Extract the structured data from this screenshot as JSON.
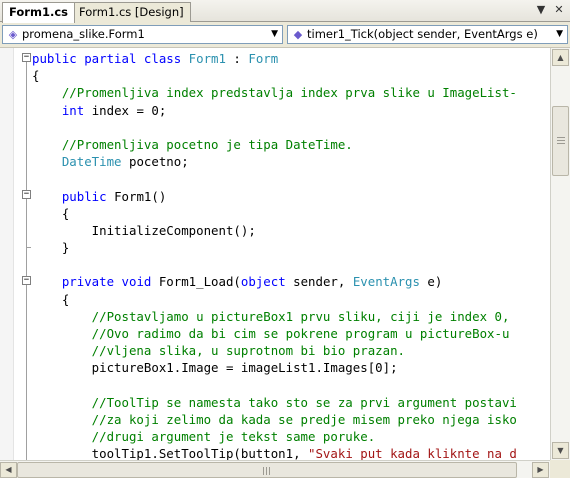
{
  "tabs": [
    {
      "label": "Form1.cs",
      "active": true
    },
    {
      "label": "Form1.cs [Design]",
      "active": false
    }
  ],
  "tab_buttons": {
    "dropdown_icon": "chevron-down-icon",
    "close_glyph": "✕"
  },
  "navigation": {
    "class_combo": {
      "value": "promena_slike.Form1",
      "icon": "class-icon"
    },
    "member_combo": {
      "value": "timer1_Tick(object sender, EventArgs e)",
      "icon": "method-icon"
    }
  },
  "code_lines": [
    [
      {
        "t": "public partial class ",
        "c": "kw"
      },
      {
        "t": "Form1",
        "c": "ty"
      },
      {
        "t": " : ",
        "c": ""
      },
      {
        "t": "Form",
        "c": "ty"
      }
    ],
    [
      {
        "t": "{",
        "c": ""
      }
    ],
    [
      {
        "t": "    //Promenljiva index predstavlja index prva slike u ImageList-",
        "c": "cm"
      }
    ],
    [
      {
        "t": "    ",
        "c": ""
      },
      {
        "t": "int",
        "c": "kw"
      },
      {
        "t": " index = 0;",
        "c": ""
      }
    ],
    [],
    [
      {
        "t": "    //Promenljiva pocetno je tipa DateTime.",
        "c": "cm"
      }
    ],
    [
      {
        "t": "    ",
        "c": ""
      },
      {
        "t": "DateTime",
        "c": "ty"
      },
      {
        "t": " pocetno;",
        "c": ""
      }
    ],
    [],
    [
      {
        "t": "    ",
        "c": ""
      },
      {
        "t": "public",
        "c": "kw"
      },
      {
        "t": " Form1()",
        "c": ""
      }
    ],
    [
      {
        "t": "    {",
        "c": ""
      }
    ],
    [
      {
        "t": "        InitializeComponent();",
        "c": ""
      }
    ],
    [
      {
        "t": "    }",
        "c": ""
      }
    ],
    [],
    [
      {
        "t": "    ",
        "c": ""
      },
      {
        "t": "private",
        "c": "kw"
      },
      {
        "t": " ",
        "c": ""
      },
      {
        "t": "void",
        "c": "kw"
      },
      {
        "t": " Form1_Load(",
        "c": ""
      },
      {
        "t": "object",
        "c": "kw"
      },
      {
        "t": " sender, ",
        "c": ""
      },
      {
        "t": "EventArgs",
        "c": "ty"
      },
      {
        "t": " e)",
        "c": ""
      }
    ],
    [
      {
        "t": "    {",
        "c": ""
      }
    ],
    [
      {
        "t": "        //Postavljamo u pictureBox1 prvu sliku, ciji je index 0,",
        "c": "cm"
      }
    ],
    [
      {
        "t": "        //Ovo radimo da bi cim se pokrene program u pictureBox-u",
        "c": "cm"
      }
    ],
    [
      {
        "t": "        //vljena slika, u suprotnom bi bio prazan.",
        "c": "cm"
      }
    ],
    [
      {
        "t": "        pictureBox1.Image = imageList1.Images[0];",
        "c": ""
      }
    ],
    [],
    [
      {
        "t": "        //ToolTip se namesta tako sto se za prvi argument postavi",
        "c": "cm"
      }
    ],
    [
      {
        "t": "        //za koji zelimo da kada se predje misem preko njega isko",
        "c": "cm"
      }
    ],
    [
      {
        "t": "        //drugi argument je tekst same poruke.",
        "c": "cm"
      }
    ],
    [
      {
        "t": "        toolTip1.SetToolTip(button1, ",
        "c": ""
      },
      {
        "t": "\"Svaki put kada kliknte na d",
        "c": "st"
      }
    ]
  ]
}
